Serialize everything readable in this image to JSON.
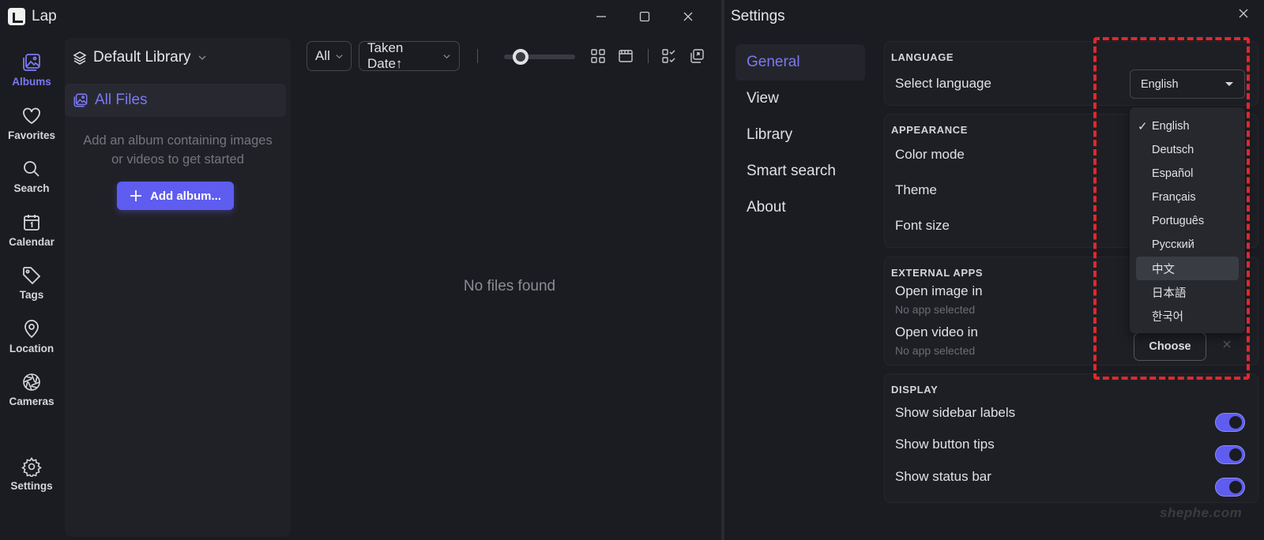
{
  "lap": {
    "title": "Lap",
    "nav": [
      {
        "label": "Albums",
        "icon": "albums-icon",
        "active": true
      },
      {
        "label": "Favorites",
        "icon": "heart-icon"
      },
      {
        "label": "Search",
        "icon": "search-icon"
      },
      {
        "label": "Calendar",
        "icon": "calendar-icon"
      },
      {
        "label": "Tags",
        "icon": "tag-icon"
      },
      {
        "label": "Location",
        "icon": "location-pin-icon"
      },
      {
        "label": "Cameras",
        "icon": "camera-aperture-icon"
      },
      {
        "label": "Settings",
        "icon": "gear-icon"
      }
    ],
    "library": "Default Library",
    "all_files": "All Files",
    "empty_hint": "Add an album containing images or videos to get started",
    "add_album": "Add album...",
    "filter": "All",
    "sort": "Taken Date↑",
    "thumbnail_size_fraction": 0.15,
    "no_files": "No files found"
  },
  "settings": {
    "title": "Settings",
    "tabs": [
      "General",
      "View",
      "Library",
      "Smart search",
      "About"
    ],
    "active_tab": "General",
    "language": {
      "header": "LANGUAGE",
      "label": "Select language",
      "selected": "English",
      "options": [
        "English",
        "Deutsch",
        "Español",
        "Français",
        "Português",
        "Русский",
        "中文",
        "日本語",
        "한국어"
      ],
      "hovered": "中文"
    },
    "appearance": {
      "header": "APPEARANCE",
      "color_mode": "Color mode",
      "theme": "Theme",
      "font_size": "Font size"
    },
    "external_apps": {
      "header": "EXTERNAL APPS",
      "open_image": "Open image in",
      "open_image_sub": "No app selected",
      "open_video": "Open video in",
      "open_video_sub": "No app selected",
      "choose": "Choose"
    },
    "display": {
      "header": "DISPLAY",
      "sidebar_labels": "Show sidebar labels",
      "button_tips": "Show button tips",
      "status_bar": "Show status bar",
      "sidebar_labels_on": true,
      "button_tips_on": true,
      "status_bar_on": true
    }
  },
  "watermark": "shephe.com",
  "colors": {
    "accent": "#5f5cf0",
    "accent_text": "#7b79f2",
    "background": "#1b1c21",
    "highlight_border": "#e0282e"
  }
}
